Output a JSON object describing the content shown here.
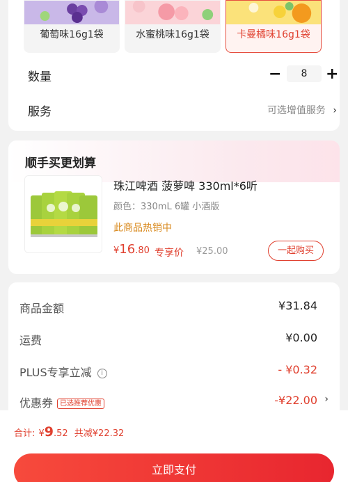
{
  "variants": [
    {
      "label": "葡萄味16g1袋",
      "selected": false,
      "color": "#8b6fbf"
    },
    {
      "label": "水蜜桃味16g1袋",
      "selected": false,
      "color": "#f5b8c2"
    },
    {
      "label": "卡曼橘味16g1袋",
      "selected": true,
      "color": "#f7b53a"
    }
  ],
  "quantity": {
    "label": "数量",
    "value": "8",
    "minus": "−",
    "plus": "+"
  },
  "service": {
    "label": "服务",
    "hint": "可选增值服务",
    "chevron": "›"
  },
  "recommend": {
    "title": "顺手买更划算",
    "product": {
      "name": "珠江啤酒 菠萝啤 330ml*6听",
      "spec": "颜色：330mL 6罐 小酒版",
      "hot": "此商品热销中",
      "price_currency": "¥",
      "price_int": "16",
      "price_dec": ".80",
      "price_tag": "专享价",
      "original_price": "¥25.00",
      "buy_button": "一起购买"
    }
  },
  "summary": {
    "goods_amount": {
      "label": "商品金额",
      "value": "¥31.84"
    },
    "shipping": {
      "label": "运费",
      "value": "¥0.00"
    },
    "plus_discount": {
      "label": "PLUS专享立减",
      "value": "- ¥0.32",
      "info_icon": "i"
    },
    "coupon": {
      "label": "优惠券",
      "tag": "已选推荐优惠",
      "value": "-¥22.00",
      "chevron": "›"
    }
  },
  "bottom": {
    "total_label": "合计:",
    "total_currency": "¥",
    "total_int": "9",
    "total_dec": ".52",
    "reduce_text": "共减¥22.32",
    "pay_button": "立即支付"
  },
  "colors": {
    "accent": "#e0402f",
    "hot": "#d98a1e",
    "page_bg": "#f2f2f2"
  }
}
